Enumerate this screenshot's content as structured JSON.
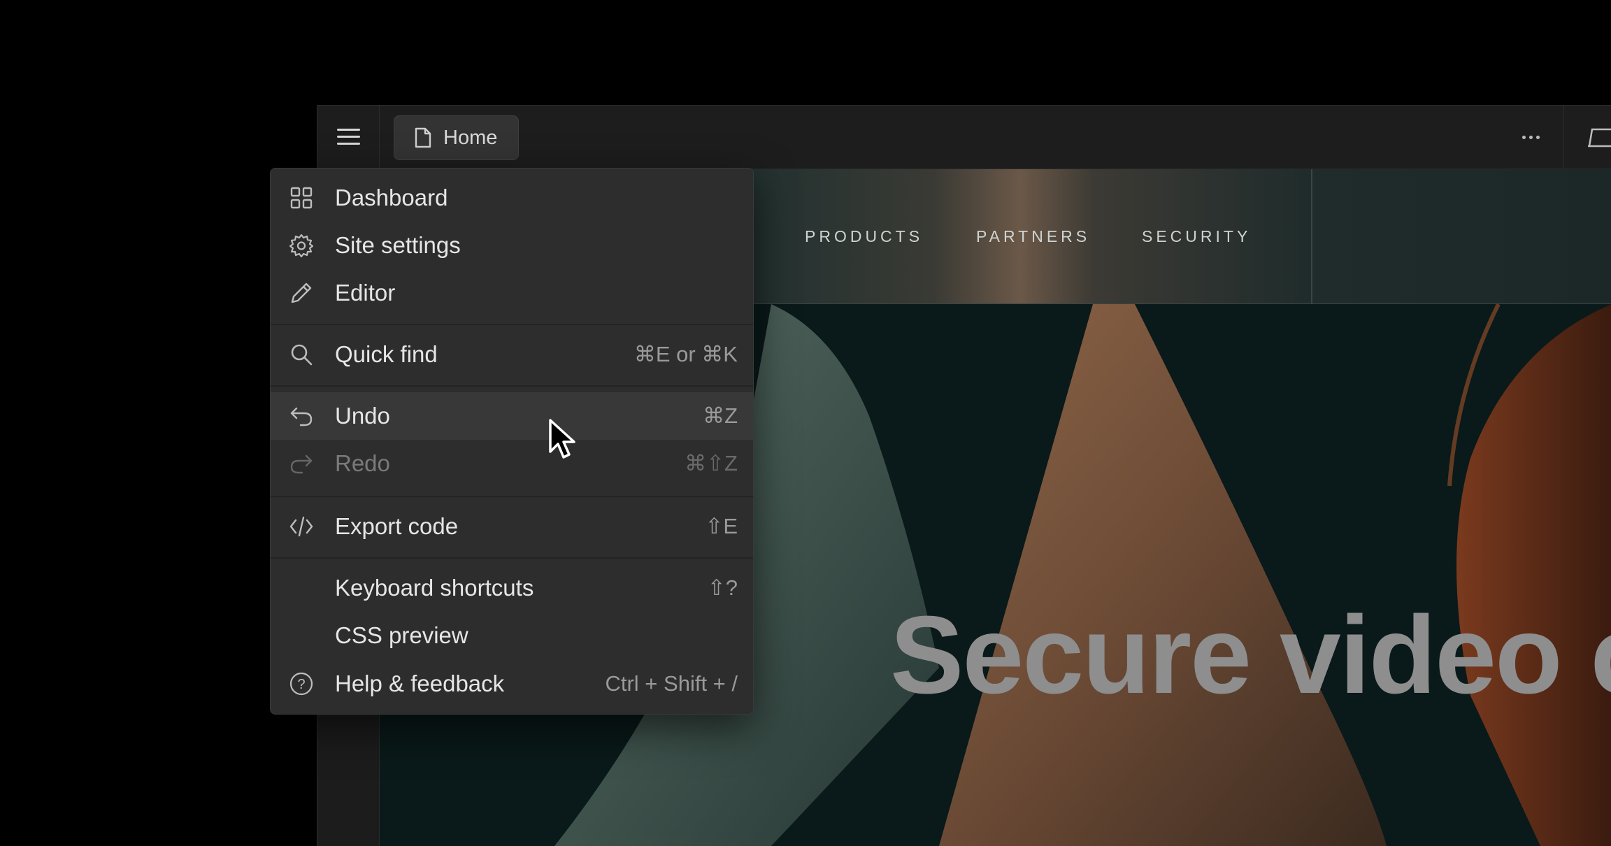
{
  "topbar": {
    "tab_label": "Home"
  },
  "site": {
    "nav": [
      "PRODUCTS",
      "PARTNERS",
      "SECURITY"
    ],
    "hero_title": "Secure video co"
  },
  "menu": {
    "items": [
      {
        "label": "Dashboard",
        "shortcut": "",
        "icon": "dashboard-icon"
      },
      {
        "label": "Site settings",
        "shortcut": "",
        "icon": "gear-icon"
      },
      {
        "label": "Editor",
        "shortcut": "",
        "icon": "pencil-icon"
      },
      {
        "label": "Quick find",
        "shortcut": "⌘E or ⌘K",
        "icon": "search-icon"
      },
      {
        "label": "Undo",
        "shortcut": "⌘Z",
        "icon": "undo-icon"
      },
      {
        "label": "Redo",
        "shortcut": "⌘⇧Z",
        "icon": "redo-icon"
      },
      {
        "label": "Export code",
        "shortcut": "⇧E",
        "icon": "code-icon"
      },
      {
        "label": "Keyboard shortcuts",
        "shortcut": "⇧?",
        "icon": ""
      },
      {
        "label": "CSS preview",
        "shortcut": "",
        "icon": ""
      },
      {
        "label": "Help & feedback",
        "shortcut": "Ctrl + Shift + /",
        "icon": "help-icon"
      }
    ]
  },
  "colors": {
    "menu_bg": "#2d2d2d",
    "menu_hover": "#383838",
    "app_bg": "#1c1c1c"
  }
}
